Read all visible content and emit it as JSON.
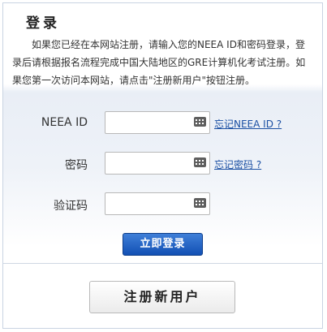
{
  "login": {
    "title": "登录",
    "intro": "如果您已经在本网站注册，请输入您的NEEA ID和密码登录，登录后请根据报名流程完成中国大陆地区的GRE计算机化考试注册。如果您第一次访问本网站，请点击\"注册新用户\"按钮注册。",
    "fields": [
      {
        "label": "NEEA ID",
        "value": "",
        "link": "忘记NEEA ID ?"
      },
      {
        "label": "密码",
        "value": "",
        "link": "忘记密码 ?"
      },
      {
        "label": "验证码",
        "value": ""
      }
    ],
    "login_button": "立即登录",
    "register_button": "注册新用户"
  },
  "icons": {
    "keyboard": "keyboard-icon"
  },
  "colors": {
    "link": "#1a4fa3",
    "login_button": "#1250b4",
    "panel_border": "#c9d3e2"
  }
}
